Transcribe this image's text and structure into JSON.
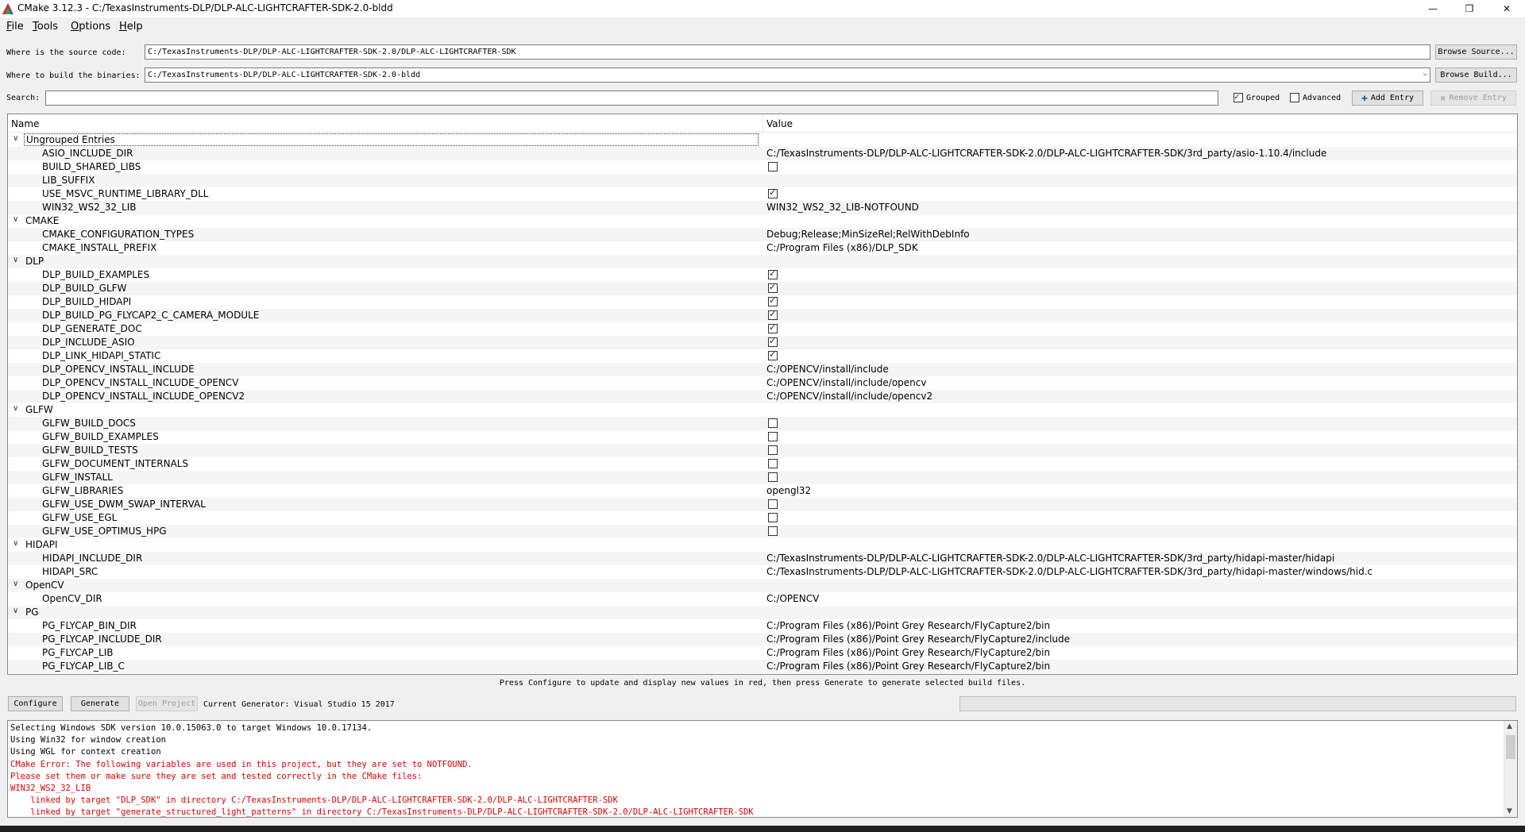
{
  "window": {
    "title": "CMake 3.12.3 - C:/TexasInstruments-DLP/DLP-ALC-LIGHTCRAFTER-SDK-2.0-bldd",
    "minimize_glyph": "—",
    "maximize_glyph": "❐",
    "close_glyph": "✕"
  },
  "menu": [
    {
      "label": "File",
      "mnemonic": "F",
      "rest": "ile"
    },
    {
      "label": "Tools",
      "mnemonic": "T",
      "rest": "ools"
    },
    {
      "label": "Options",
      "mnemonic": "O",
      "rest": "ptions"
    },
    {
      "label": "Help",
      "mnemonic": "H",
      "rest": "elp"
    }
  ],
  "source": {
    "label": "Where is the source code:",
    "value": "C:/TexasInstruments-DLP/DLP-ALC-LIGHTCRAFTER-SDK-2.0/DLP-ALC-LIGHTCRAFTER-SDK",
    "browse_label": "Browse Source..."
  },
  "build": {
    "label": "Where to build the binaries:",
    "value": "C:/TexasInstruments-DLP/DLP-ALC-LIGHTCRAFTER-SDK-2.0-bldd",
    "browse_label": "Browse Build..."
  },
  "search": {
    "label": "Search:",
    "value": "",
    "grouped_label": "Grouped",
    "grouped_checked": true,
    "advanced_label": "Advanced",
    "advanced_checked": false,
    "add_entry_label": "Add Entry",
    "remove_entry_label": "Remove Entry"
  },
  "tree": {
    "columns": [
      "Name",
      "Value"
    ],
    "groups": [
      {
        "name": "Ungrouped Entries",
        "focused": true,
        "entries": [
          {
            "name": "ASIO_INCLUDE_DIR",
            "value": "C:/TexasInstruments-DLP/DLP-ALC-LIGHTCRAFTER-SDK-2.0/DLP-ALC-LIGHTCRAFTER-SDK/3rd_party/asio-1.10.4/include"
          },
          {
            "name": "BUILD_SHARED_LIBS",
            "bool": false
          },
          {
            "name": "LIB_SUFFIX",
            "value": ""
          },
          {
            "name": "USE_MSVC_RUNTIME_LIBRARY_DLL",
            "bool": true
          },
          {
            "name": "WIN32_WS2_32_LIB",
            "value": "WIN32_WS2_32_LIB-NOTFOUND"
          }
        ]
      },
      {
        "name": "CMAKE",
        "entries": [
          {
            "name": "CMAKE_CONFIGURATION_TYPES",
            "value": "Debug;Release;MinSizeRel;RelWithDebInfo"
          },
          {
            "name": "CMAKE_INSTALL_PREFIX",
            "value": "C:/Program Files (x86)/DLP_SDK"
          }
        ]
      },
      {
        "name": "DLP",
        "entries": [
          {
            "name": "DLP_BUILD_EXAMPLES",
            "bool": true
          },
          {
            "name": "DLP_BUILD_GLFW",
            "bool": true
          },
          {
            "name": "DLP_BUILD_HIDAPI",
            "bool": true
          },
          {
            "name": "DLP_BUILD_PG_FLYCAP2_C_CAMERA_MODULE",
            "bool": true
          },
          {
            "name": "DLP_GENERATE_DOC",
            "bool": true
          },
          {
            "name": "DLP_INCLUDE_ASIO",
            "bool": true
          },
          {
            "name": "DLP_LINK_HIDAPI_STATIC",
            "bool": true
          },
          {
            "name": "DLP_OPENCV_INSTALL_INCLUDE",
            "value": "C:/OPENCV/install/include"
          },
          {
            "name": "DLP_OPENCV_INSTALL_INCLUDE_OPENCV",
            "value": "C:/OPENCV/install/include/opencv"
          },
          {
            "name": "DLP_OPENCV_INSTALL_INCLUDE_OPENCV2",
            "value": "C:/OPENCV/install/include/opencv2"
          }
        ]
      },
      {
        "name": "GLFW",
        "entries": [
          {
            "name": "GLFW_BUILD_DOCS",
            "bool": false
          },
          {
            "name": "GLFW_BUILD_EXAMPLES",
            "bool": false
          },
          {
            "name": "GLFW_BUILD_TESTS",
            "bool": false
          },
          {
            "name": "GLFW_DOCUMENT_INTERNALS",
            "bool": false
          },
          {
            "name": "GLFW_INSTALL",
            "bool": false
          },
          {
            "name": "GLFW_LIBRARIES",
            "value": "opengl32"
          },
          {
            "name": "GLFW_USE_DWM_SWAP_INTERVAL",
            "bool": false
          },
          {
            "name": "GLFW_USE_EGL",
            "bool": false
          },
          {
            "name": "GLFW_USE_OPTIMUS_HPG",
            "bool": false
          }
        ]
      },
      {
        "name": "HIDAPI",
        "entries": [
          {
            "name": "HIDAPI_INCLUDE_DIR",
            "value": "C:/TexasInstruments-DLP/DLP-ALC-LIGHTCRAFTER-SDK-2.0/DLP-ALC-LIGHTCRAFTER-SDK/3rd_party/hidapi-master/hidapi"
          },
          {
            "name": "HIDAPI_SRC",
            "value": "C:/TexasInstruments-DLP/DLP-ALC-LIGHTCRAFTER-SDK-2.0/DLP-ALC-LIGHTCRAFTER-SDK/3rd_party/hidapi-master/windows/hid.c"
          }
        ]
      },
      {
        "name": "OpenCV",
        "entries": [
          {
            "name": "OpenCV_DIR",
            "value": "C:/OPENCV"
          }
        ]
      },
      {
        "name": "PG",
        "entries": [
          {
            "name": "PG_FLYCAP_BIN_DIR",
            "value": "C:/Program Files (x86)/Point Grey Research/FlyCapture2/bin"
          },
          {
            "name": "PG_FLYCAP_INCLUDE_DIR",
            "value": "C:/Program Files (x86)/Point Grey Research/FlyCapture2/include"
          },
          {
            "name": "PG_FLYCAP_LIB",
            "value": "C:/Program Files (x86)/Point Grey Research/FlyCapture2/bin"
          },
          {
            "name": "PG_FLYCAP_LIB_C",
            "value": "C:/Program Files (x86)/Point Grey Research/FlyCapture2/bin"
          }
        ]
      }
    ]
  },
  "status_message": "Press Configure to update and display new values in red, then press Generate to generate selected build files.",
  "actions": {
    "configure_label": "Configure",
    "generate_label": "Generate",
    "open_project_label": "Open Project",
    "generator_text": "Current Generator: Visual Studio 15 2017"
  },
  "output": [
    {
      "text": "Selecting Windows SDK version 10.0.15063.0 to target Windows 10.0.17134.",
      "error": false
    },
    {
      "text": "Using Win32 for window creation",
      "error": false
    },
    {
      "text": "Using WGL for context creation",
      "error": false
    },
    {
      "text": "CMake Error: The following variables are used in this project, but they are set to NOTFOUND.",
      "error": true
    },
    {
      "text": "Please set them or make sure they are set and tested correctly in the CMake files:",
      "error": true
    },
    {
      "text": "WIN32_WS2_32_LIB",
      "error": true
    },
    {
      "text": "    linked by target \"DLP_SDK\" in directory C:/TexasInstruments-DLP/DLP-ALC-LIGHTCRAFTER-SDK-2.0/DLP-ALC-LIGHTCRAFTER-SDK",
      "error": true
    },
    {
      "text": "    linked by target \"generate_structured_light_patterns\" in directory C:/TexasInstruments-DLP/DLP-ALC-LIGHTCRAFTER-SDK-2.0/DLP-ALC-LIGHTCRAFTER-SDK",
      "error": true
    }
  ],
  "colors": {
    "error_text": "#e00000",
    "row_alt": "#f5f5f5"
  }
}
